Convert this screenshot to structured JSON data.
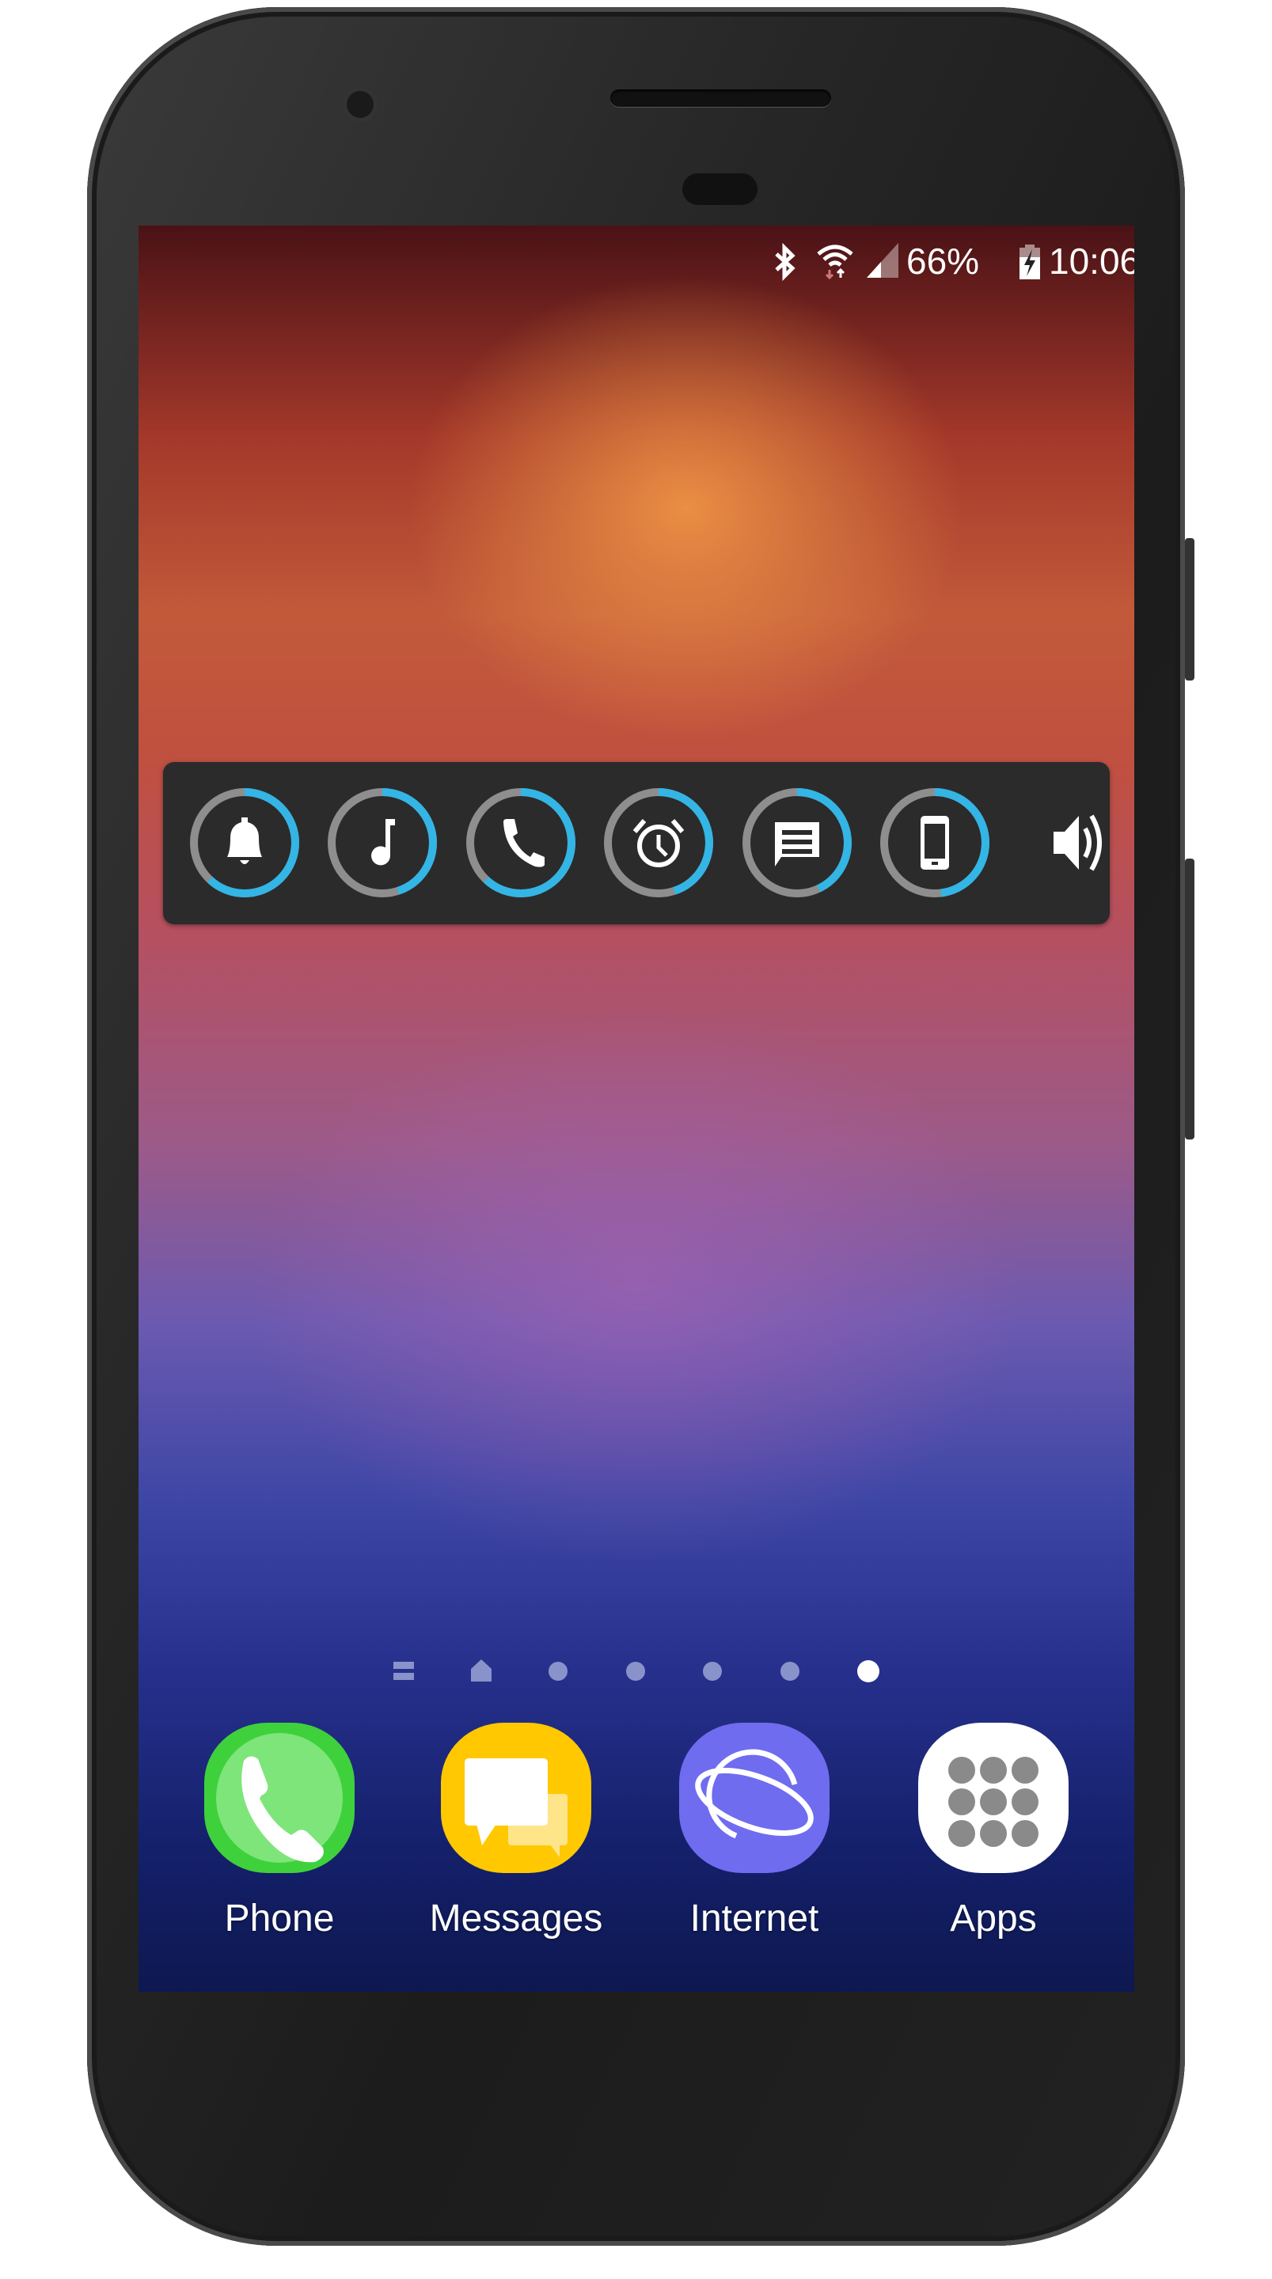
{
  "status_bar": {
    "icons": [
      "bluetooth-icon",
      "wifi-icon",
      "cell-signal-icon",
      "battery-charging-icon"
    ],
    "battery": "66%",
    "time": "10:06"
  },
  "volume_widget": {
    "accent_color": "#33b5e5",
    "track_color": "#8e8e8e",
    "sliders": [
      {
        "name": "notification",
        "icon": "bell-icon",
        "level": 0.62
      },
      {
        "name": "media",
        "icon": "music-note-icon",
        "level": 0.45
      },
      {
        "name": "ringtone",
        "icon": "phone-icon",
        "level": 0.62
      },
      {
        "name": "alarm",
        "icon": "alarm-clock-icon",
        "level": 0.45
      },
      {
        "name": "message",
        "icon": "message-icon",
        "level": 0.43
      },
      {
        "name": "system",
        "icon": "smartphone-icon",
        "level": 0.48
      }
    ],
    "speaker_icon": "speaker-icon"
  },
  "page_indicator": {
    "pages": 7,
    "active": 6
  },
  "dock": [
    {
      "label": "Phone",
      "color": "#3ed13c"
    },
    {
      "label": "Messages",
      "color": "#ffc800"
    },
    {
      "label": "Internet",
      "color": "#6f6cf0"
    },
    {
      "label": "Apps",
      "color": "#ffffff"
    }
  ]
}
